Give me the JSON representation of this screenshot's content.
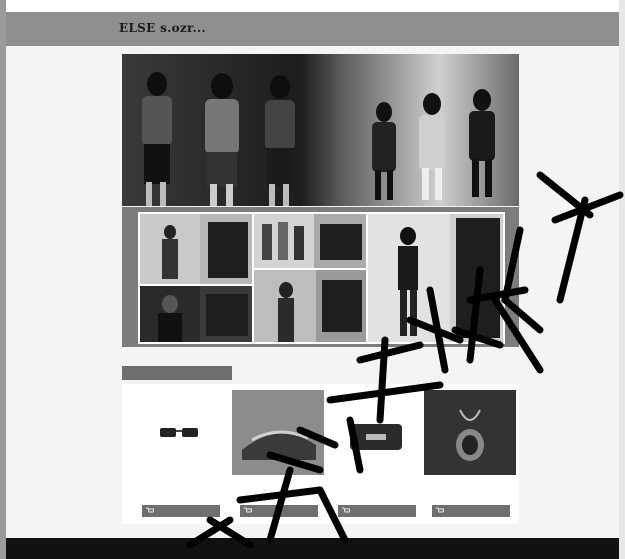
{
  "header": {
    "logo": "ELSE s.ozr...",
    "nav": [
      "",
      "",
      "",
      "",
      ""
    ]
  },
  "grid": {
    "labels": [
      "",
      "",
      "",
      "",
      ""
    ]
  },
  "products": {
    "heading": "",
    "items": [
      {
        "name": "",
        "button": ""
      },
      {
        "name": "",
        "button": ""
      },
      {
        "name": "",
        "button": ""
      },
      {
        "name": "",
        "button": ""
      }
    ]
  },
  "footer": {
    "copyright": ""
  },
  "colors": {
    "header": "#8f8f8f",
    "footer": "#111111",
    "button": "#6f6f6f"
  }
}
